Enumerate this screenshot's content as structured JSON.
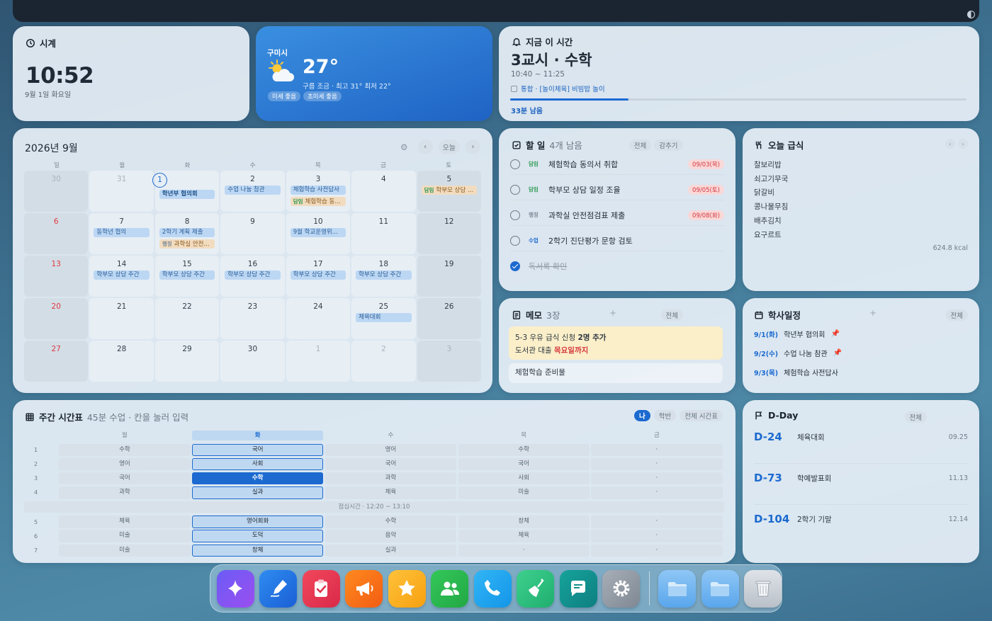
{
  "clock": {
    "title": "시계",
    "time": "10:52",
    "date": "9월 1일 화요일"
  },
  "weather": {
    "city": "구미시",
    "temp": "27°",
    "desc": "구름 조금 · 최고 31° 최저 22°",
    "chips": [
      "미세 좋음",
      "초미세 좋음"
    ]
  },
  "now": {
    "title": "지금 이 시간",
    "period": "3교시 · 수학",
    "range": "10:40 ~ 11:25",
    "topic": "통합 · [놀이체육] 비빔밥 놀이",
    "progress": 0.26,
    "remaining": "33분 남음"
  },
  "calendar": {
    "title": "2026년 9월",
    "today_label": "오늘",
    "dow": [
      "일",
      "월",
      "화",
      "수",
      "목",
      "금",
      "토"
    ],
    "days": [
      {
        "n": "30",
        "other": true
      },
      {
        "n": "31",
        "other": true
      },
      {
        "n": "1",
        "today": true,
        "ev": [
          {
            "t": "학년부 협의회",
            "bold": true
          }
        ]
      },
      {
        "n": "2",
        "ev": [
          {
            "t": "수업 나눔 참관"
          }
        ]
      },
      {
        "n": "3",
        "ev": [
          {
            "t": "체험학습 사전답사"
          },
          {
            "tag": "담임",
            "t": "체험학습 동...",
            "orange": true
          }
        ]
      },
      {
        "n": "4"
      },
      {
        "n": "5",
        "ev": [
          {
            "tag": "담임",
            "t": "학부모 상담 ...",
            "orange": true
          }
        ]
      },
      {
        "n": "6"
      },
      {
        "n": "7",
        "ev": [
          {
            "t": "동학년 협의"
          }
        ]
      },
      {
        "n": "8",
        "ev": [
          {
            "t": "2학기 계획 제출"
          },
          {
            "tag": "행정",
            "t": "과학실 안전...",
            "orange": true
          }
        ]
      },
      {
        "n": "9"
      },
      {
        "n": "10",
        "ev": [
          {
            "t": "9월 학교운영위..."
          }
        ]
      },
      {
        "n": "11"
      },
      {
        "n": "12"
      },
      {
        "n": "13"
      },
      {
        "n": "14",
        "ev": [
          {
            "t": "학부모 상담 주간"
          }
        ]
      },
      {
        "n": "15",
        "ev": [
          {
            "t": "학부모 상담 주간"
          }
        ]
      },
      {
        "n": "16",
        "ev": [
          {
            "t": "학부모 상담 주간"
          }
        ]
      },
      {
        "n": "17",
        "ev": [
          {
            "t": "학부모 상담 주간"
          }
        ]
      },
      {
        "n": "18",
        "ev": [
          {
            "t": "학부모 상담 주간"
          }
        ]
      },
      {
        "n": "19"
      },
      {
        "n": "20"
      },
      {
        "n": "21"
      },
      {
        "n": "22"
      },
      {
        "n": "23"
      },
      {
        "n": "24"
      },
      {
        "n": "25",
        "ev": [
          {
            "t": "체육대회"
          }
        ]
      },
      {
        "n": "26"
      },
      {
        "n": "27"
      },
      {
        "n": "28"
      },
      {
        "n": "29"
      },
      {
        "n": "30"
      },
      {
        "n": "1",
        "other": true
      },
      {
        "n": "2",
        "other": true
      },
      {
        "n": "3",
        "other": true
      }
    ]
  },
  "todo": {
    "title": "할 일",
    "count": "4개 남음",
    "filters": [
      "전체",
      "감추기"
    ],
    "items": [
      {
        "tag": "담임",
        "tagc": "g",
        "text": "체험학습 동의서 취합",
        "due": "09/03(목)"
      },
      {
        "tag": "담임",
        "tagc": "g",
        "text": "학부모 상담 일정 조율",
        "due": "09/05(토)"
      },
      {
        "tag": "행정",
        "tagc": "gray",
        "text": "과학실 안전점검표 제출",
        "due": "09/08(화)"
      },
      {
        "tag": "수업",
        "tagc": "b",
        "text": "2학기 진단평가 문항 검토",
        "due": ""
      },
      {
        "tag": "",
        "tagc": "",
        "text": "독서록 확인",
        "due": "",
        "done": true
      }
    ]
  },
  "meal": {
    "title": "오늘 급식",
    "items": [
      "찰보리밥",
      "쇠고기무국",
      "닭갈비",
      "콩나물무침",
      "배추김치",
      "요구르트"
    ],
    "kcal": "624.8 kcal"
  },
  "memo": {
    "title": "메모",
    "count": "3장",
    "all": "전체",
    "note1_a": "5-3 우유 급식 신청 ",
    "note1_b": "2명 추가",
    "note1_c": "도서관 대출 ",
    "note1_d": "목요일까지",
    "note2": "체험학습 준비물"
  },
  "academic": {
    "title": "학사일정",
    "all": "전체",
    "items": [
      {
        "d": "9/1(화)",
        "t": "학년부 협의회",
        "pin": true
      },
      {
        "d": "9/2(수)",
        "t": "수업 나눔 참관",
        "pin": true
      },
      {
        "d": "9/3(목)",
        "t": "체험학습 사전답사",
        "pin": false
      }
    ]
  },
  "timetable": {
    "title": "주간 시간표",
    "sub": "45분 수업 · 칸을 눌러 입력",
    "toggles": [
      "나",
      "학반",
      "전체 시간표"
    ],
    "days": [
      "월",
      "화",
      "수",
      "목",
      "금"
    ],
    "lunch": "점심시간 · 12:20 ~ 13:10",
    "rows": [
      [
        "1",
        [
          "수학",
          "국어",
          "영어",
          "수학",
          "·"
        ]
      ],
      [
        "2",
        [
          "영어",
          "사회",
          "국어",
          "국어",
          "·"
        ]
      ],
      [
        "3",
        [
          "국어",
          "수학",
          "과학",
          "사회",
          "·"
        ]
      ],
      [
        "4",
        [
          "과학",
          "실과",
          "체육",
          "미술",
          "·"
        ]
      ],
      [
        "5",
        [
          "체육",
          "영어회화",
          "수학",
          "창체",
          "·"
        ]
      ],
      [
        "6",
        [
          "미술",
          "도덕",
          "음악",
          "체육",
          "·"
        ]
      ],
      [
        "7",
        [
          "미술",
          "창체",
          "실과",
          "·",
          "·"
        ]
      ]
    ]
  },
  "dday": {
    "title": "D-Day",
    "all": "전체",
    "items": [
      {
        "d": "D-24",
        "n": "체육대회",
        "dt": "09.25"
      },
      {
        "d": "D-73",
        "n": "학예발표회",
        "dt": "11.13"
      },
      {
        "d": "D-104",
        "n": "2학기 기말",
        "dt": "12.14"
      }
    ]
  },
  "dock": [
    "sparkle-icon",
    "pen-icon",
    "clipboard-check-icon",
    "megaphone-icon",
    "star-icon",
    "people-icon",
    "phone-icon",
    "broom-icon",
    "chat-icon",
    "settings-icon",
    "folder-icon",
    "folder-icon",
    "trash-icon"
  ]
}
